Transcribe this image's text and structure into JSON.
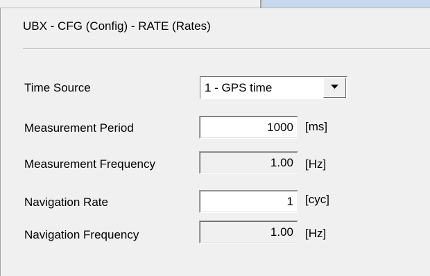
{
  "header": {
    "title": "UBX - CFG (Config) - RATE (Rates)"
  },
  "time_source": {
    "label": "Time Source",
    "value": "1 - GPS time"
  },
  "measurement_period": {
    "label": "Measurement Period",
    "value": "1000",
    "unit": "[ms]"
  },
  "measurement_frequency": {
    "label": "Measurement Frequency",
    "value": "1.00",
    "unit": "[Hz]"
  },
  "navigation_rate": {
    "label": "Navigation Rate",
    "value": "1",
    "unit": "[cyc]"
  },
  "navigation_frequency": {
    "label": "Navigation Frequency",
    "value": "1.00",
    "unit": "[Hz]"
  },
  "icons": {
    "dropdown": "chevron-down-icon"
  },
  "colors": {
    "background": "#f0f0f0",
    "edit_background": "#ffffff",
    "top_strip_accent": "#c8d8ec"
  }
}
